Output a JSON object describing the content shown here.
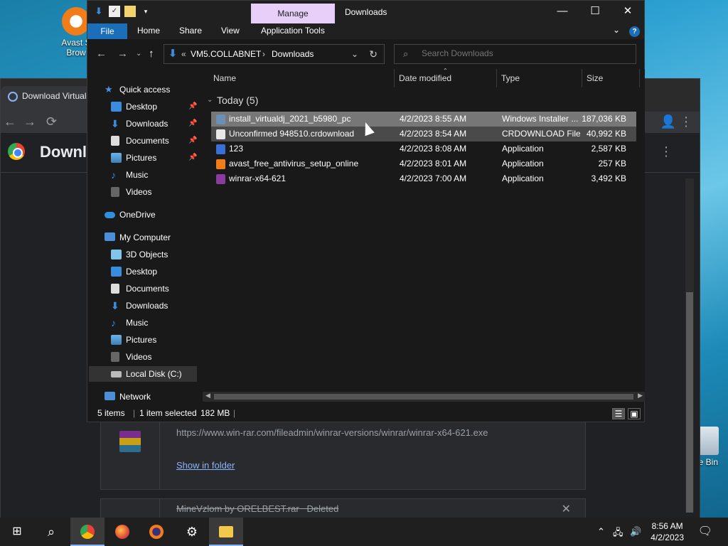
{
  "desktop": {
    "icon_label": "Avast S Brow",
    "recycle_label": "le Bin"
  },
  "chrome": {
    "tab_title": "Download Virtual",
    "page_title": "Downlo",
    "download_url": "https://www.win-rar.com/fileadmin/winrar-versions/winrar/winrar-x64-621.exe",
    "show_in_folder": "Show in folder",
    "deleted_item": "MineVzlom by ORELBEST.rar",
    "deleted_status": "Deleted"
  },
  "explorer": {
    "qat_items": [
      "download-icon",
      "checkbox-icon",
      "folder-icon"
    ],
    "manage_tab": "Manage",
    "window_title": "Downloads",
    "ribbon_tabs": [
      "File",
      "Home",
      "Share",
      "View",
      "Application Tools"
    ],
    "address": {
      "chevron": "«",
      "part1": "VM5.COLLABNET",
      "sep": "›",
      "part2": "Downloads"
    },
    "search_placeholder": "Search Downloads",
    "nav": {
      "quick_access": "Quick access",
      "qa_items": [
        "Desktop",
        "Downloads",
        "Documents",
        "Pictures",
        "Music",
        "Videos"
      ],
      "onedrive": "OneDrive",
      "my_computer": "My Computer",
      "pc_items": [
        "3D Objects",
        "Desktop",
        "Documents",
        "Downloads",
        "Music",
        "Pictures",
        "Videos",
        "Local Disk (C:)"
      ],
      "network": "Network"
    },
    "columns": [
      "Name",
      "Date modified",
      "Type",
      "Size"
    ],
    "group_label": "Today (5)",
    "files": [
      {
        "name": "install_virtualdj_2021_b5980_pc",
        "date": "4/2/2023 8:55 AM",
        "type": "Windows Installer ...",
        "size": "187,036 KB",
        "color": "#6d8fb5"
      },
      {
        "name": "Unconfirmed 948510.crdownload",
        "date": "4/2/2023 8:54 AM",
        "type": "CRDOWNLOAD File",
        "size": "40,992 KB",
        "color": "#e8e8e8"
      },
      {
        "name": "123",
        "date": "4/2/2023 8:08 AM",
        "type": "Application",
        "size": "2,587 KB",
        "color": "#3a6fd8"
      },
      {
        "name": "avast_free_antivirus_setup_online",
        "date": "4/2/2023 8:01 AM",
        "type": "Application",
        "size": "257 KB",
        "color": "#f07d1a"
      },
      {
        "name": "winrar-x64-621",
        "date": "4/2/2023 7:00 AM",
        "type": "Application",
        "size": "3,492 KB",
        "color": "#8b3a9e"
      }
    ],
    "status": {
      "items": "5 items",
      "selected": "1 item selected",
      "size": "182 MB"
    }
  },
  "taskbar": {
    "time": "8:56 AM",
    "date": "4/2/2023"
  }
}
